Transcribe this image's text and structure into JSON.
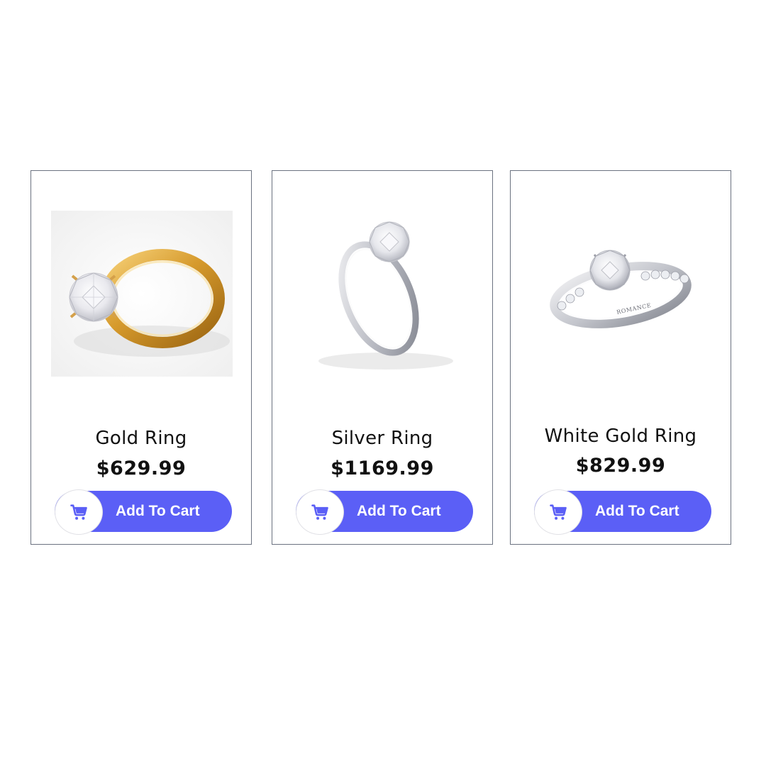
{
  "colors": {
    "accent": "#5b5ff6",
    "card_border": "#6b7280",
    "text": "#111111",
    "button_text": "#ffffff"
  },
  "products": [
    {
      "name": "Gold Ring",
      "price": "$629.99",
      "button_label": "Add To Cart",
      "button_icon": "shopping-cart-icon",
      "image": "gold-solitaire-ring"
    },
    {
      "name": "Silver Ring",
      "price": "$1169.99",
      "button_label": "Add To Cart",
      "button_icon": "shopping-cart-icon",
      "image": "silver-solitaire-ring"
    },
    {
      "name": "White Gold Ring",
      "price": "$829.99",
      "button_label": "Add To Cart",
      "button_icon": "shopping-cart-icon",
      "image": "white-gold-pave-ring",
      "engraving": "ROMANCE"
    }
  ]
}
